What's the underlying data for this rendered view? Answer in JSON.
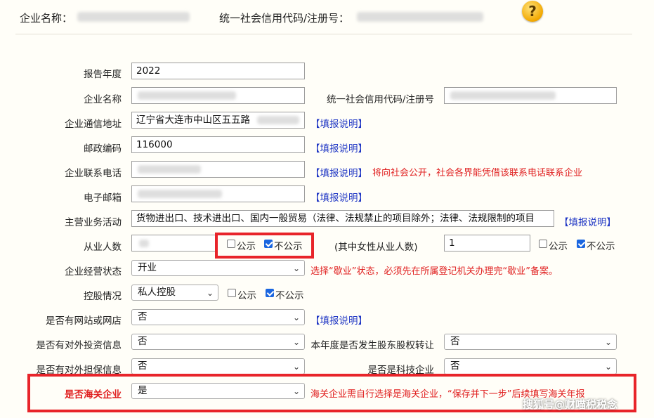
{
  "header": {
    "company_name_label": "企业名称：",
    "credit_code_label": "统一社会信用代码/注册号："
  },
  "form": {
    "report_year": {
      "label": "报告年度",
      "value": "2022"
    },
    "company_name": {
      "label": "企业名称"
    },
    "credit_code": {
      "label": "统一社会信用代码/注册号"
    },
    "address": {
      "label": "企业通信地址",
      "value": "辽宁省大连市中山区五五路",
      "link": "【填报说明】"
    },
    "postcode": {
      "label": "邮政编码",
      "value": "116000",
      "link": "【填报说明】"
    },
    "phone": {
      "label": "企业联系电话",
      "link": "【填报说明】",
      "note": "将向社会公开，社会各界能凭借该联系电话联系企业"
    },
    "email": {
      "label": "电子邮箱",
      "link": "【填报说明】"
    },
    "business": {
      "label": "主营业务活动",
      "value": "货物进出口、技术进出口、国内一般贸易（法律、法规禁止的项目除外；法律、法规限制的项目",
      "link": "【填报说明】"
    },
    "employees": {
      "label": "从业人数",
      "public": "公示",
      "nonpublic": "不公示"
    },
    "female_employees": {
      "label": "(其中女性从业人数)",
      "value": "1",
      "public": "公示",
      "nonpublic": "不公示"
    },
    "status": {
      "label": "企业经营状态",
      "value": "开业",
      "note": "选择“歇业”状态，必须先在所属登记机关办理完“歇业”备案。"
    },
    "holding": {
      "label": "控股情况",
      "value": "私人控股",
      "public": "公示",
      "nonpublic": "不公示"
    },
    "website": {
      "label": "是否有网站或网店",
      "value": "否",
      "link": "【填报说明】"
    },
    "investment": {
      "label": "是否有对外投资信息",
      "value": "否"
    },
    "equity_transfer": {
      "label": "本年度是否发生股东股权转让",
      "value": "否"
    },
    "guarantee": {
      "label": "是否有对外担保信息",
      "value": "否"
    },
    "tech": {
      "label": "是否是科技企业",
      "value": "否"
    },
    "customs": {
      "label": "是否海关企业",
      "value": "是",
      "note": "海关企业需自行选择是海关企业，“保存并下一步”后续填写海关年报"
    }
  },
  "watermark": "搜狐号@财喵税税念",
  "help_icon": "question-icon",
  "colors": {
    "accent_red": "#e02020",
    "link_blue": "#1f36c4",
    "checkbox_blue": "#1a66e0",
    "highlight_box": "#e8242a"
  }
}
